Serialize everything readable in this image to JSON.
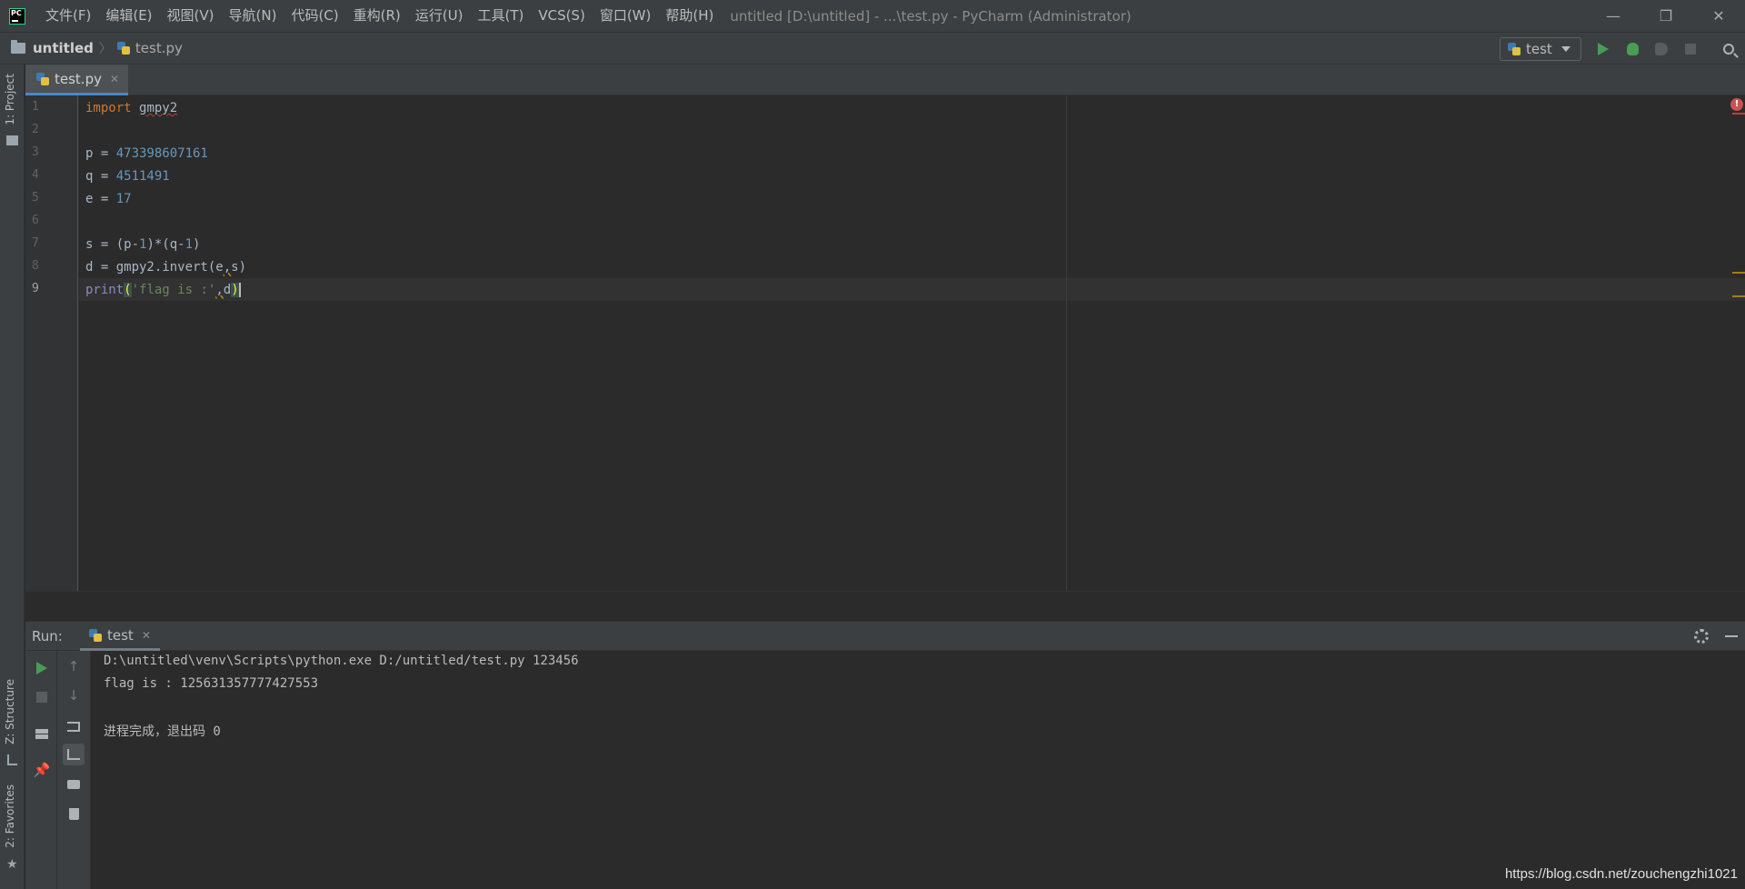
{
  "window": {
    "title": "untitled [D:\\untitled] - ...\\test.py - PyCharm (Administrator)",
    "minimize_glyph": "—",
    "restore_glyph": "❐",
    "close_glyph": "✕"
  },
  "menu": {
    "items": [
      "文件(F)",
      "编辑(E)",
      "视图(V)",
      "导航(N)",
      "代码(C)",
      "重构(R)",
      "运行(U)",
      "工具(T)",
      "VCS(S)",
      "窗口(W)",
      "帮助(H)"
    ]
  },
  "navbar": {
    "project": "untitled",
    "separator": "〉",
    "file": "test.py",
    "run_config": "test"
  },
  "left_stripe": {
    "project_tab": "1: Project",
    "structure_tab": "Z: Structure",
    "favorites_tab": "2: Favorites"
  },
  "editor": {
    "tab_label": "test.py",
    "tab_close": "✕",
    "line_numbers": [
      "1",
      "2",
      "3",
      "4",
      "5",
      "6",
      "7",
      "8",
      "9"
    ],
    "active_line": 9,
    "lines": {
      "l1_kw": "import",
      "l1_mod": "gmpy2",
      "l3_lhs": "p = ",
      "l3_val": "473398607161",
      "l4_lhs": "q = ",
      "l4_val": "4511491",
      "l5_lhs": "e = ",
      "l5_val": "17",
      "l7_a": "s = (p-",
      "l7_b": "1",
      "l7_c": ")*(q-",
      "l7_d": "1",
      "l7_e": ")",
      "l8_a": "d = gmpy2.invert(e",
      "l8_comma": ",",
      "l8_b": "s)",
      "l9_fn": "print",
      "l9_open": "(",
      "l9_str": "'flag is :'",
      "l9_comma": ",",
      "l9_arg": "d",
      "l9_close": ")"
    },
    "error_icon": "!"
  },
  "run": {
    "title": "Run:",
    "tab_label": "test",
    "tab_close": "✕",
    "up_arrow": "↑",
    "down_arrow": "↓",
    "console": [
      "D:\\untitled\\venv\\Scripts\\python.exe D:/untitled/test.py 123456",
      "flag is : 125631357777427553",
      "",
      "进程完成，退出码 0"
    ]
  },
  "watermark": "https://blog.csdn.net/zouchengzhi1021",
  "colors": {
    "run_green": "#499c54",
    "keyword": "#cc7832",
    "number": "#6897bb",
    "string": "#6a8759",
    "builtin": "#8888c6"
  }
}
